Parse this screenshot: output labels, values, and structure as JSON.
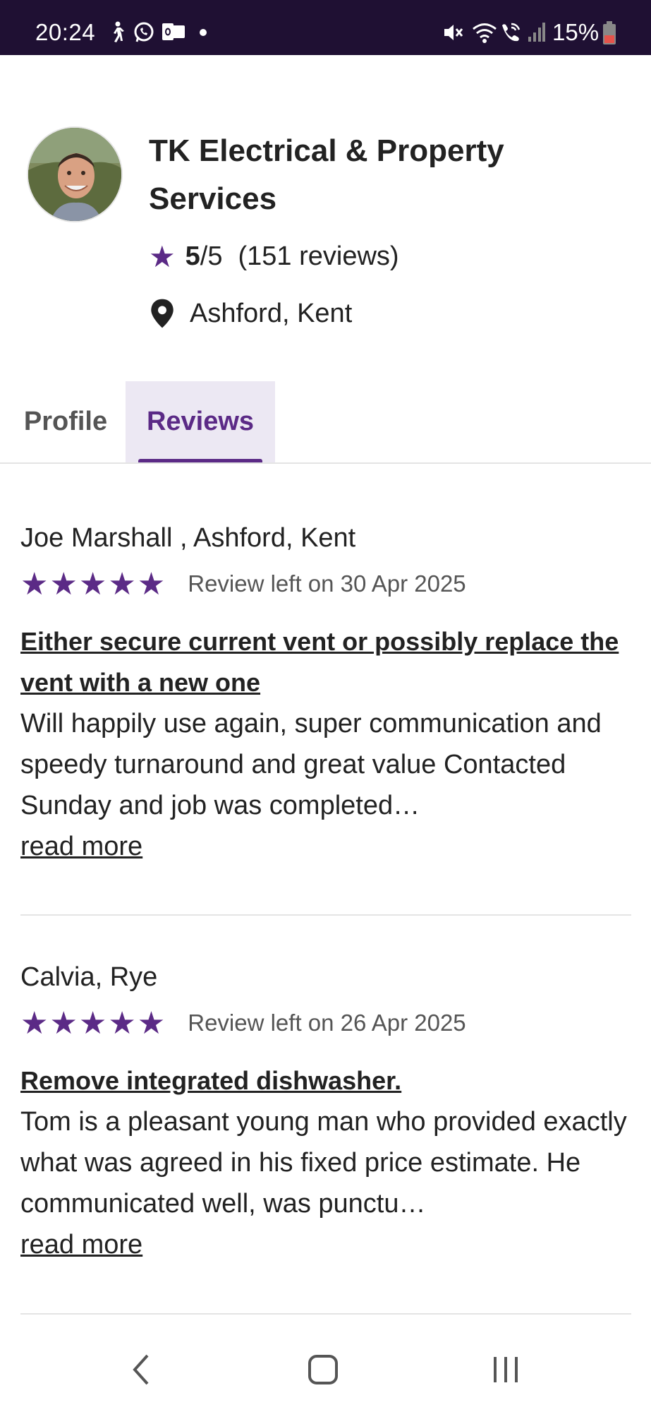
{
  "status_bar": {
    "time": "20:24",
    "battery": "15%",
    "left_icons": [
      "walk-icon",
      "whatsapp-icon",
      "outlook-icon",
      "dot-icon"
    ],
    "right_icons": [
      "mute-icon",
      "wifi-icon",
      "wifi-call-icon",
      "signal-icon",
      "battery-icon"
    ]
  },
  "business": {
    "name": "TK Electrical & Property Services",
    "rating_score": "5",
    "rating_out_of": "/5",
    "review_count": "(151 reviews)",
    "location": "Ashford, Kent"
  },
  "tabs": [
    {
      "label": "Profile",
      "active": false
    },
    {
      "label": "Reviews",
      "active": true
    }
  ],
  "reviews": [
    {
      "reviewer": "Joe Marshall , Ashford, Kent",
      "stars": "★★★★★",
      "rating": 5,
      "date": "Review left on 30 Apr 2025",
      "title": "Either secure current vent or possibly replace the vent with a new one",
      "body": "Will happily use again, super communication and speedy turnaround and great value Contacted Sunday and job was completed…",
      "read_more": "read more"
    },
    {
      "reviewer": "Calvia, Rye",
      "stars": "★★★★★",
      "rating": 5,
      "date": "Review left on 26 Apr 2025",
      "title": "Remove integrated dishwasher.",
      "body": "Tom is a pleasant young man who provided exactly what was agreed in his fixed price estimate. He communicated well, was punctu…",
      "read_more": "read more"
    }
  ],
  "nav_bar": {
    "buttons": [
      "back-icon",
      "home-icon",
      "recents-icon"
    ]
  },
  "colors": {
    "accent": "#5b2a86",
    "status_bar": "#1f1033",
    "tab_active_bg": "#ece8f3",
    "battery_low": "#e5534b"
  }
}
